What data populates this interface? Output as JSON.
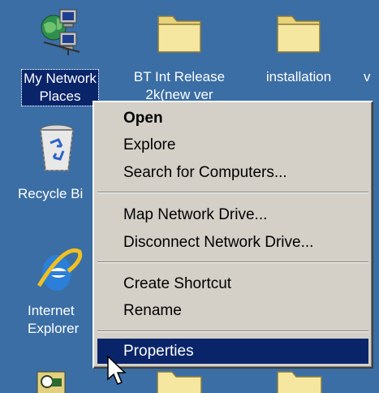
{
  "desktop": {
    "background_color": "#3a6ea5",
    "icons": [
      {
        "label": "My Network\nPlaces",
        "icon": "network-places-icon",
        "selected": true
      },
      {
        "label": "BT Int Release\n2k(new ver",
        "icon": "folder-icon"
      },
      {
        "label": "installation",
        "icon": "folder-icon"
      },
      {
        "label": "v",
        "icon": "folder-icon"
      },
      {
        "label": "Recycle Bi",
        "icon": "recycle-bin-icon"
      },
      {
        "label": "Internet\nExplorer",
        "icon": "internet-explorer-icon"
      }
    ]
  },
  "context_menu": {
    "items": [
      {
        "label": "Open",
        "default": true
      },
      {
        "label": "Explore"
      },
      {
        "label": "Search for Computers..."
      },
      {
        "label": "Map Network Drive..."
      },
      {
        "label": "Disconnect Network Drive..."
      },
      {
        "label": "Create Shortcut"
      },
      {
        "label": "Rename"
      },
      {
        "label": "Properties",
        "highlighted": true
      }
    ],
    "highlight_color": "#0a246a",
    "background_color": "#d4d0c8"
  }
}
